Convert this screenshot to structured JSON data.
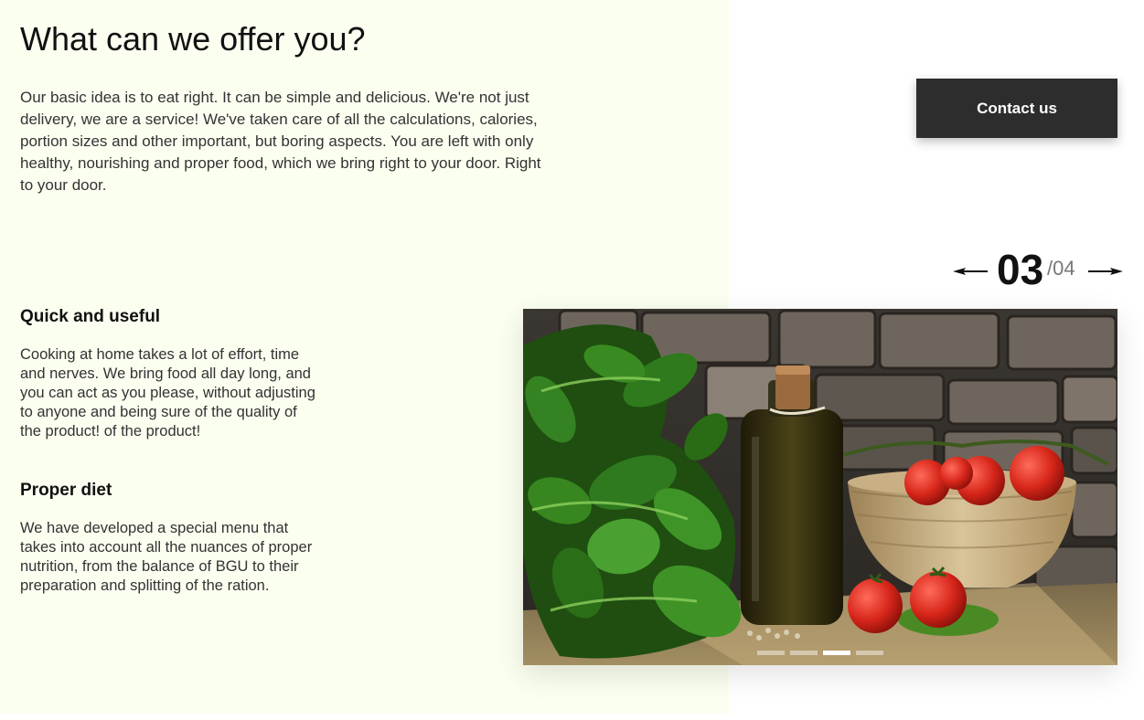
{
  "section": {
    "title": "What can we offer you?",
    "intro": "Our basic idea is to eat right. It can be simple and delicious. We're not just delivery, we are a service! We've taken care of all the calculations, calories, portion sizes and other important, but boring aspects. You are left with only healthy, nourishing and proper food, which we bring right to your door. Right to your door."
  },
  "contact_button": {
    "label": "Contact us"
  },
  "slider": {
    "current": "03",
    "total": "/04",
    "active_slide": 3,
    "slide_count": 4,
    "prev_icon": "arrow-left-icon",
    "next_icon": "arrow-right-icon"
  },
  "features": [
    {
      "title": "Quick and useful",
      "text": "Cooking at home takes a lot of effort, time and nerves. We bring food all day long, and you can act as you please, without adjusting to anyone and being sure of the quality of the product! of the product!"
    },
    {
      "title": "Proper diet",
      "text": "We have developed a special menu that takes into account all the nuances of proper nutrition, from the balance of BGU to their preparation and splitting of the ration."
    }
  ],
  "colors": {
    "panel_tint": "#fbfff0",
    "button": "#2d2d2d",
    "text": "#333333"
  }
}
